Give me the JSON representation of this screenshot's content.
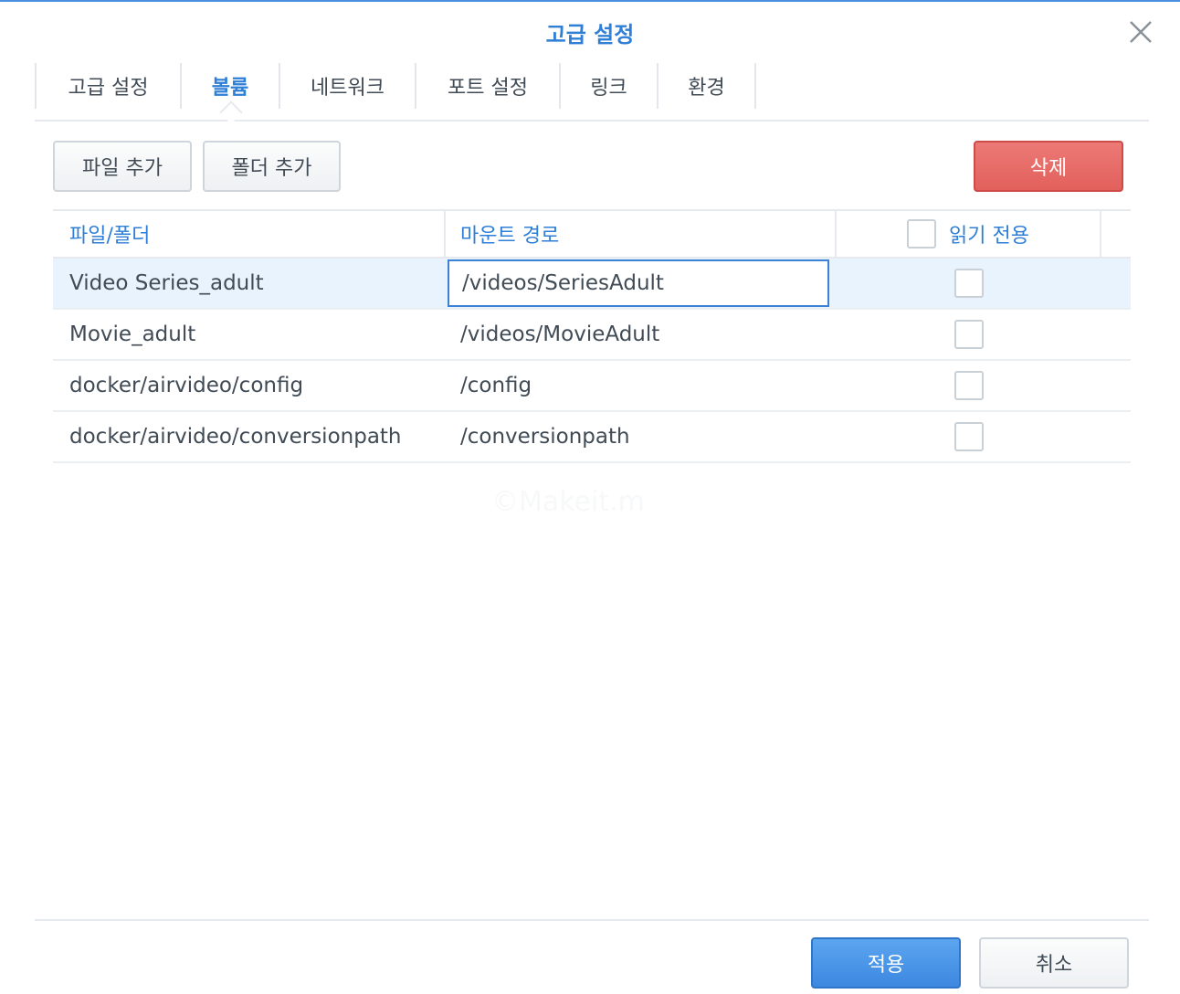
{
  "dialog": {
    "title": "고급 설정",
    "watermark": "©Makeit.m"
  },
  "tabs": [
    {
      "label": "고급 설정",
      "active": false
    },
    {
      "label": "볼륨",
      "active": true
    },
    {
      "label": "네트워크",
      "active": false
    },
    {
      "label": "포트 설정",
      "active": false
    },
    {
      "label": "링크",
      "active": false
    },
    {
      "label": "환경",
      "active": false
    }
  ],
  "toolbar": {
    "add_file_label": "파일 추가",
    "add_folder_label": "폴더 추가",
    "delete_label": "삭제"
  },
  "table": {
    "columns": {
      "file_folder": "파일/폴더",
      "mount_path": "마운트 경로",
      "read_only": "읽기 전용"
    },
    "rows": [
      {
        "file_folder": "Video Series_adult",
        "mount_path": "/videos/SeriesAdult",
        "read_only": false,
        "selected": true
      },
      {
        "file_folder": "Movie_adult",
        "mount_path": "/videos/MovieAdult",
        "read_only": false,
        "selected": false
      },
      {
        "file_folder": "docker/airvideo/config",
        "mount_path": "/config",
        "read_only": false,
        "selected": false
      },
      {
        "file_folder": "docker/airvideo/conversionpath",
        "mount_path": "/conversionpath",
        "read_only": false,
        "selected": false
      }
    ]
  },
  "footer": {
    "apply_label": "적용",
    "cancel_label": "취소"
  },
  "colors": {
    "accent": "#2f7fd6",
    "danger": "#e2605c",
    "selected_row": "#e8f3fd"
  }
}
